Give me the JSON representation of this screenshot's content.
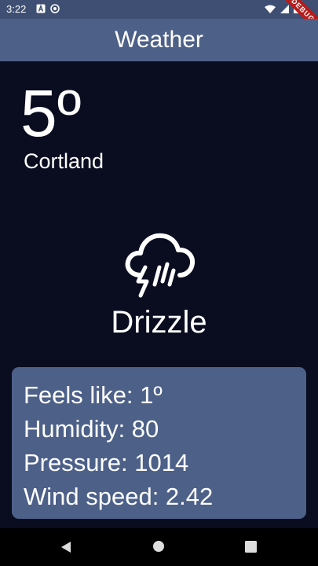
{
  "status_bar": {
    "time": "3:22",
    "debug_label": "DEBUG"
  },
  "app_bar": {
    "title": "Weather"
  },
  "current": {
    "temperature": "5º",
    "city": "Cortland",
    "condition": "Drizzle",
    "condition_icon": "cloud-drizzle-thunder-icon"
  },
  "details": {
    "feels_like": "Feels like: 1º",
    "humidity": "Humidity: 80",
    "pressure": "Pressure: 1014",
    "wind_speed": "Wind speed: 2.42"
  },
  "colors": {
    "background": "#0a0d20",
    "app_bar": "#4d6088",
    "status_bar": "#3e4f73",
    "card": "#4d6088",
    "text": "#ffffff"
  },
  "nav": {
    "icons": [
      "back-icon",
      "home-icon",
      "recents-icon"
    ]
  }
}
